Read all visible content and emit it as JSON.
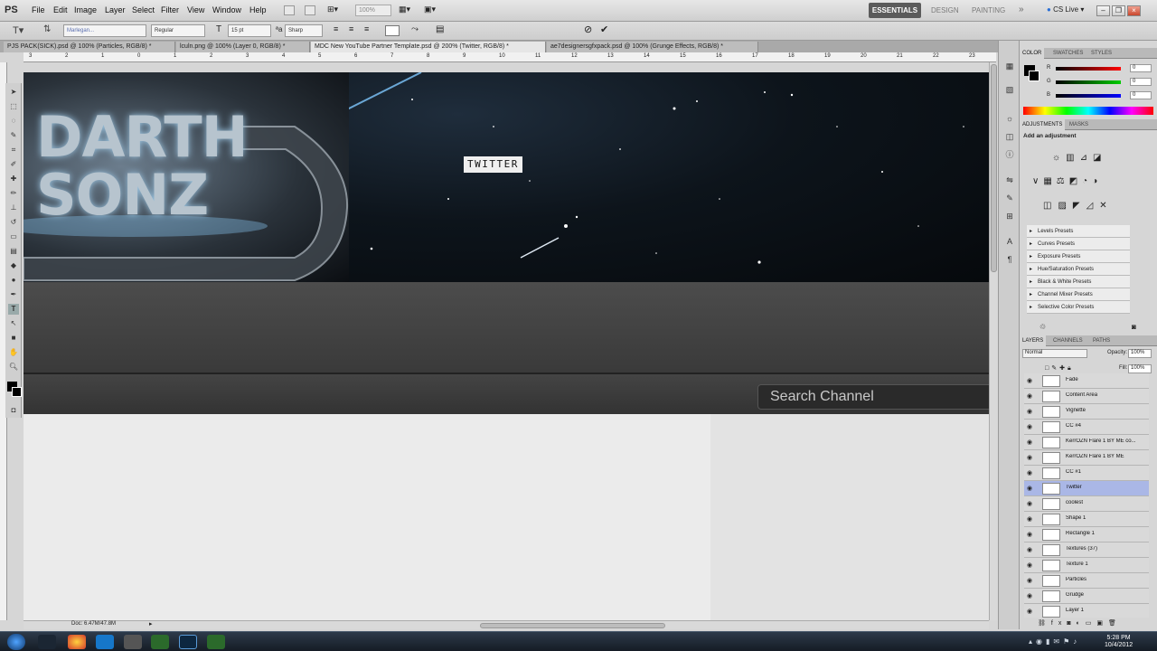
{
  "menubar": {
    "logo": "PS",
    "items": [
      "File",
      "Edit",
      "Image",
      "Layer",
      "Select",
      "Filter",
      "View",
      "Window",
      "Help"
    ],
    "zoom": "100%",
    "workspaces": {
      "active": "ESSENTIALS",
      "others": [
        "DESIGN",
        "PAINTING"
      ]
    },
    "cs_live": "CS Live"
  },
  "options": {
    "font_family": "Marlegan...",
    "font_style": "Regular",
    "font_size": "15 pt",
    "antialias": "Sharp"
  },
  "tabs": [
    "PJS PACK(SICK).psd @ 100% (Particles, RGB/8) *",
    "lculn.png @ 100% (Layer 0, RGB/8) *",
    "MDC New YouTube Partner Template.psd @ 200% (Twitter, RGB/8) *",
    "ae7designersgfxpack.psd @ 100% (Grunge Effects, RGB/8) *"
  ],
  "ruler_marks": [
    "3",
    "2",
    "1",
    "0",
    "1",
    "2",
    "3",
    "4",
    "5",
    "6",
    "7",
    "8",
    "9",
    "10",
    "11",
    "12",
    "13",
    "14",
    "15",
    "16",
    "17",
    "18",
    "19",
    "20",
    "21",
    "22",
    "23",
    "24"
  ],
  "canvas": {
    "logo_text": "DARTH\nSONZ",
    "twitter_label": "TWITTER",
    "search_placeholder": "Search Channel"
  },
  "status": {
    "doc": "Doc: 6.47M/47.8M"
  },
  "color_panel": {
    "tabs": [
      "COLOR",
      "SWATCHES",
      "STYLES"
    ],
    "r": "0",
    "g": "0",
    "b": "0",
    "r_label": "R",
    "g_label": "G",
    "b_label": "B"
  },
  "adjustments_panel": {
    "tabs": [
      "ADJUSTMENTS",
      "MASKS"
    ],
    "heading": "Add an adjustment",
    "presets": [
      "Levels Presets",
      "Curves Presets",
      "Exposure Presets",
      "Hue/Saturation Presets",
      "Black & White Presets",
      "Channel Mixer Presets",
      "Selective Color Presets"
    ]
  },
  "layers_panel": {
    "tabs": [
      "LAYERS",
      "CHANNELS",
      "PATHS"
    ],
    "blend_mode": "Normal",
    "opacity_label": "Opacity:",
    "opacity": "100%",
    "fill_label": "Fill:",
    "fill": "100%",
    "layers": [
      {
        "name": "Fade",
        "selected": false
      },
      {
        "name": "Content Area",
        "selected": false
      },
      {
        "name": "Vignette",
        "selected": false
      },
      {
        "name": "CC #4",
        "selected": false
      },
      {
        "name": "KerrOZN Flare 1 BY ME co...",
        "selected": false
      },
      {
        "name": "KerrOZN Flare 1 BY ME",
        "selected": false
      },
      {
        "name": "CC #1",
        "selected": false
      },
      {
        "name": "Twitter",
        "selected": true
      },
      {
        "name": "coolest",
        "selected": false
      },
      {
        "name": "Shape 1",
        "selected": false
      },
      {
        "name": "Rectangle 1",
        "selected": false
      },
      {
        "name": "Textures (37)",
        "selected": false
      },
      {
        "name": "Texture 1",
        "selected": false
      },
      {
        "name": "Particles",
        "selected": false
      },
      {
        "name": "Grudge",
        "selected": false
      },
      {
        "name": "Layer 1",
        "selected": false
      }
    ]
  },
  "taskbar": {
    "time": "5:28 PM",
    "date": "10/4/2012"
  },
  "colors": {
    "accent": "#aab7e6",
    "active_workspace": "#5b5b5b"
  }
}
